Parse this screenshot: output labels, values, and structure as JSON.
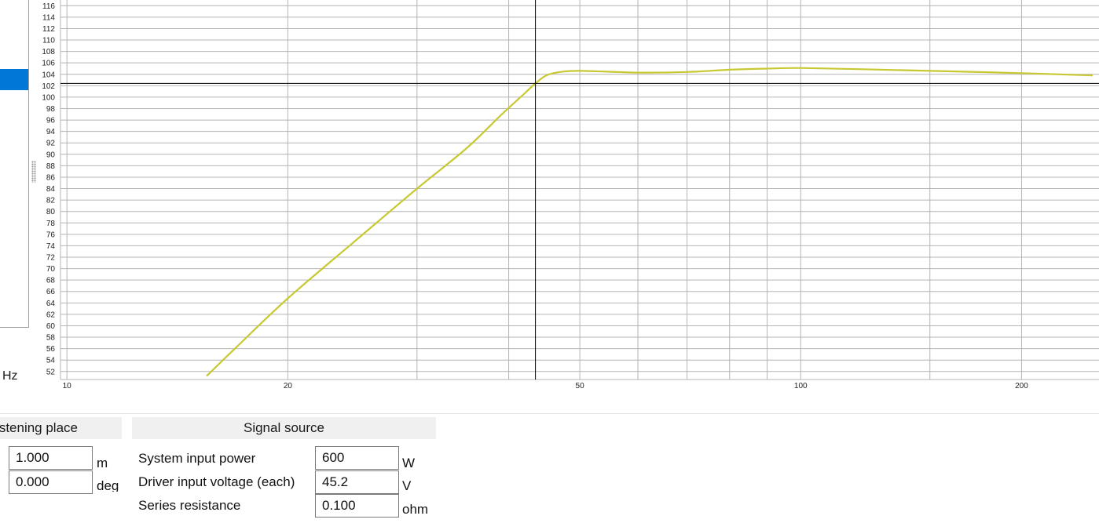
{
  "left_panel": {},
  "unit_label": "Hz",
  "chart_data": {
    "type": "line",
    "x_scale": "log",
    "xlim": [
      9.8,
      255
    ],
    "ylim": [
      50.6,
      117
    ],
    "x_ticks": [
      {
        "value": 10,
        "label": "10"
      },
      {
        "value": 20,
        "label": "20"
      },
      {
        "value": 50,
        "label": "50"
      },
      {
        "value": 100,
        "label": "100"
      },
      {
        "value": 200,
        "label": "200"
      }
    ],
    "x_minor_gridlines": [
      30,
      40,
      60,
      70,
      80,
      90,
      150
    ],
    "y_ticks": [
      52,
      54,
      56,
      58,
      60,
      62,
      64,
      66,
      68,
      70,
      72,
      74,
      76,
      78,
      80,
      82,
      84,
      86,
      88,
      90,
      92,
      94,
      96,
      98,
      100,
      102,
      104,
      106,
      108,
      110,
      112,
      114,
      116
    ],
    "grid": true,
    "cursor": {
      "x": 43.5,
      "y": 102.4
    },
    "series": [
      {
        "color": "#c8c832",
        "x": [
          15.5,
          17,
          20,
          25,
          30,
          35,
          39,
          42,
          43.5,
          45,
          47,
          50,
          60,
          70,
          80,
          90,
          100,
          120,
          150,
          200,
          250
        ],
        "y": [
          51.2,
          56.2,
          64.8,
          75.4,
          84.0,
          91.0,
          96.8,
          100.6,
          102.4,
          103.8,
          104.4,
          104.6,
          104.3,
          104.4,
          104.8,
          105.0,
          105.1,
          104.9,
          104.6,
          104.2,
          103.8
        ]
      }
    ]
  },
  "listening_place": {
    "header": "stening place",
    "distance": {
      "value": "1.000",
      "unit": "m"
    },
    "angle": {
      "value": "0.000",
      "unit": "deg"
    }
  },
  "signal_source": {
    "header": "Signal source",
    "rows": [
      {
        "label": "System input power",
        "value": "600",
        "unit": "W"
      },
      {
        "label": "Driver input voltage (each)",
        "value": "45.2",
        "unit": "V"
      },
      {
        "label": "Series resistance",
        "value": "0.100",
        "unit": "ohm"
      }
    ]
  }
}
